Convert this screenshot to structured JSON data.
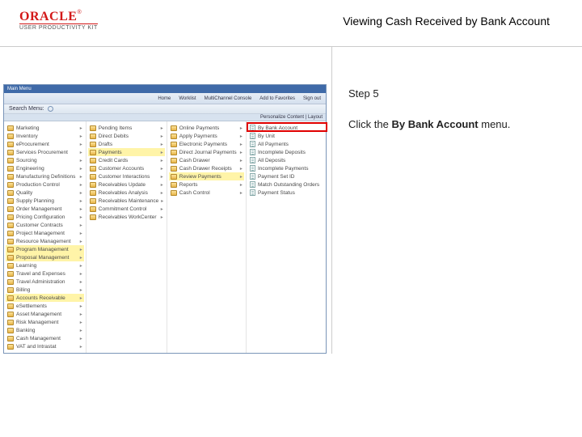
{
  "header": {
    "logo_main": "ORACLE",
    "logo_tm": "®",
    "logo_sub": "USER PRODUCTIVITY KIT",
    "title": "Viewing Cash Received by Bank Account"
  },
  "right": {
    "step": "Step 5",
    "instr_pre": "Click the ",
    "instr_bold": "By Bank Account",
    "instr_post": " menu."
  },
  "app": {
    "tabrow": {
      "t1": "Main Menu"
    },
    "toolbar": {
      "home": "Home",
      "worklist": "Worklist",
      "mcl": "MultiChannel Console",
      "add": "Add to Favorites",
      "sign": "Sign out"
    },
    "panel_label": "Search Menu:",
    "subhdr": "Personalize Content | Layout",
    "col1": [
      "Marketing",
      "Inventory",
      "eProcurement",
      "Services Procurement",
      "Sourcing",
      "Engineering",
      "Manufacturing Definitions",
      "Production Control",
      "Quality",
      "Supply Planning",
      "Order Management",
      "Pricing Configuration",
      "Customer Contracts",
      "Project Management",
      "Resource Management",
      "Program Management",
      "Proposal Management",
      "Learning",
      "Travel and Expenses",
      "Travel Administration",
      "Billing",
      "Accounts Receivable",
      "eSettlements",
      "Asset Management",
      "Risk Management",
      "Banking",
      "Cash Management",
      "VAT and Intrastat"
    ],
    "col1_highlights": [
      15,
      16,
      21
    ],
    "col2": [
      "Pending Items",
      "Direct Debits",
      "Drafts",
      "Payments",
      "Credit Cards",
      "Customer Accounts",
      "Customer Interactions",
      "Receivables Update",
      "Receivables Analysis",
      "Receivables Maintenance",
      "Commitment Control",
      "Receivables WorkCenter"
    ],
    "col2_highlights": [
      3
    ],
    "col3": [
      "Online Payments",
      "Apply Payments",
      "Electronic Payments",
      "Direct Journal Payments",
      "Cash Drawer",
      "Cash Drawer Receipts",
      "Review Payments",
      "Reports",
      "Cash Control"
    ],
    "col3_highlights": [
      6
    ],
    "col4": [
      "By Bank Account",
      "By Unit",
      "All Payments",
      "Incomplete Deposits",
      "All Deposits",
      "Incomplete Payments",
      "Payment Set ID",
      "Match Outstanding Orders",
      "Payment Status"
    ]
  }
}
